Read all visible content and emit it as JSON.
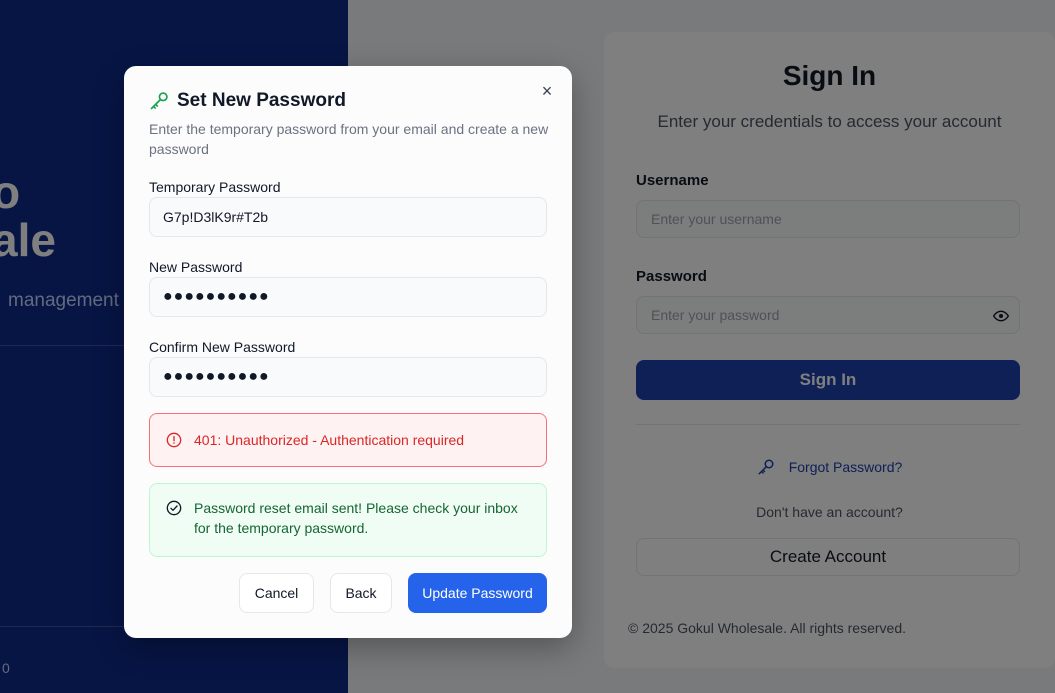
{
  "brand": {
    "title_line1": "o",
    "title_line2": "ale",
    "tagline": "management",
    "footer": "0"
  },
  "signin": {
    "title": "Sign In",
    "subtitle": "Enter your credentials to access your account",
    "username_label": "Username",
    "username_placeholder": "Enter your username",
    "password_label": "Password",
    "password_placeholder": "Enter your password",
    "submit_label": "Sign In",
    "forgot_label": "Forgot Password?",
    "no_account_text": "Don't have an account?",
    "create_label": "Create Account",
    "copyright": "© 2025 Gokul Wholesale. All rights reserved."
  },
  "modal": {
    "title": "Set New Password",
    "description": "Enter the temporary password from your email and create a new password",
    "temp_label": "Temporary Password",
    "temp_value": "G7p!D3lK9r#T2b",
    "new_label": "New Password",
    "new_value": "●●●●●●●●●●",
    "confirm_label": "Confirm New Password",
    "confirm_value": "●●●●●●●●●●",
    "error_text": "401: Unauthorized - Authentication required",
    "success_text": "Password reset email sent! Please check your inbox for the temporary password.",
    "cancel_label": "Cancel",
    "back_label": "Back",
    "update_label": "Update Password",
    "close_glyph": "×"
  },
  "colors": {
    "brand_blue": "#0e2a8a",
    "primary": "#2563eb",
    "error": "#dc2626",
    "success": "#166534",
    "key_icon": "#16a34a"
  },
  "icons": {
    "modal_header": "key-icon",
    "close": "close-icon",
    "error": "alert-circle-icon",
    "success": "check-circle-icon",
    "forgot": "key-icon",
    "password_toggle": "eye-icon"
  }
}
